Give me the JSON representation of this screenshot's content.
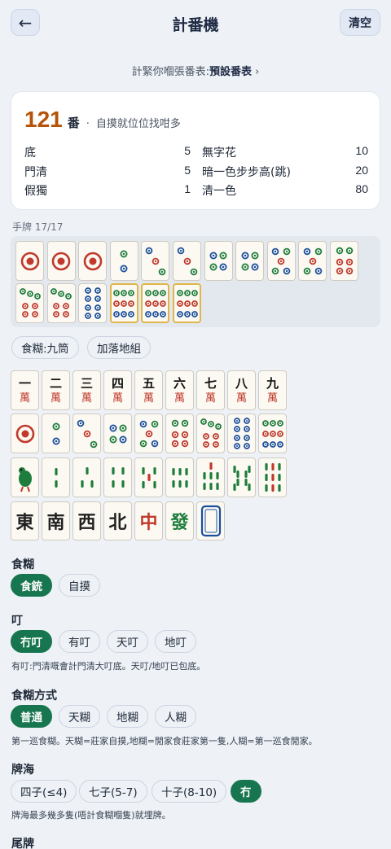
{
  "header": {
    "back_icon": "←",
    "title": "計番機",
    "clear_label": "清空"
  },
  "rules": {
    "prefix": "計緊你嗰張番表:",
    "table_name": "預設番表",
    "chevron": "›"
  },
  "result": {
    "total": "121",
    "unit": "番",
    "separator": "·",
    "summary": "自摸就位位找咁多",
    "faan": [
      {
        "name": "底",
        "value": "5"
      },
      {
        "name": "無字花",
        "value": "10"
      },
      {
        "name": "門清",
        "value": "5"
      },
      {
        "name": "暗一色步步高(跳)",
        "value": "20"
      },
      {
        "name": "假獨",
        "value": "1"
      },
      {
        "name": "清一色",
        "value": "80"
      }
    ]
  },
  "hand": {
    "label": "手牌 17/17",
    "tiles": [
      "1t",
      "1t",
      "1t",
      "2t",
      "3t",
      "3t",
      "4t",
      "4t",
      "5t",
      "5t",
      "6t",
      "7t",
      "7t",
      "8t",
      "9t",
      "9t",
      "9t"
    ],
    "highlighted": [
      14,
      15,
      16
    ]
  },
  "hand_actions": {
    "win_tile": "食糊:九筒",
    "add_meld": "加落地組"
  },
  "palette": {
    "man": [
      {
        "num": "一",
        "suit": "萬"
      },
      {
        "num": "二",
        "suit": "萬"
      },
      {
        "num": "三",
        "suit": "萬"
      },
      {
        "num": "四",
        "suit": "萬"
      },
      {
        "num": "五",
        "suit": "萬"
      },
      {
        "num": "六",
        "suit": "萬"
      },
      {
        "num": "七",
        "suit": "萬"
      },
      {
        "num": "八",
        "suit": "萬"
      },
      {
        "num": "九",
        "suit": "萬"
      }
    ],
    "honors": [
      {
        "char": "東",
        "color": "#222222"
      },
      {
        "char": "南",
        "color": "#222222"
      },
      {
        "char": "西",
        "color": "#222222"
      },
      {
        "char": "北",
        "color": "#222222"
      },
      {
        "char": "中",
        "color": "#c0392b"
      },
      {
        "char": "發",
        "color": "#1e7d3c"
      }
    ]
  },
  "win_type": {
    "title": "食糊",
    "options": [
      "食銃",
      "自摸"
    ],
    "selected": 0
  },
  "ding": {
    "title": "叮",
    "options": [
      "冇叮",
      "有叮",
      "天叮",
      "地叮"
    ],
    "selected": 0,
    "note": "有叮:門清嘅會計門清大叮底。天叮/地叮已包底。"
  },
  "win_method": {
    "title": "食糊方式",
    "options": [
      "普通",
      "天糊",
      "地糊",
      "人糊"
    ],
    "selected": 0,
    "note": "第一巡食糊。天糊=莊家自摸,地糊=閒家食莊家第一隻,人糊=第一巡食閒家。"
  },
  "wall": {
    "title": "牌海",
    "options": [
      "四子(≤4)",
      "七子(5-7)",
      "十子(8-10)",
      "冇"
    ],
    "selected": 3,
    "note": "牌海最多幾多隻(唔計食糊嗰隻)就埋牌。"
  },
  "tail": {
    "title": "尾牌"
  },
  "colors": {
    "accent_green": "#17764f",
    "score_orange": "#b45309",
    "man_red": "#c0392b",
    "dot_blue": "#1b4f9c",
    "dot_green": "#1e7d3c",
    "dot_red": "#c0392b"
  }
}
